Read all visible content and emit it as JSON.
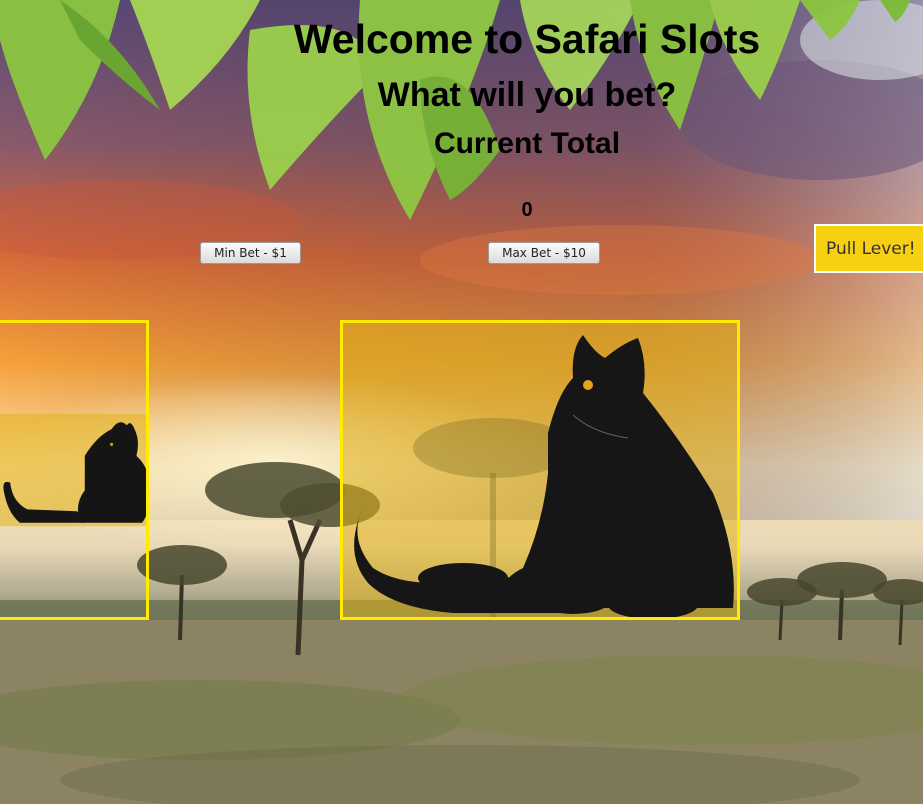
{
  "header": {
    "title": "Welcome to Safari Slots",
    "subtitle": "What will you bet?",
    "total_label": "Current Total",
    "total_value": "0"
  },
  "controls": {
    "min_bet_label": "Min Bet - $1",
    "max_bet_label": "Max Bet - $10",
    "lever_label": "Pull Lever!"
  },
  "slots": [
    {
      "icon": "black-panther-icon"
    },
    {
      "icon": "black-panther-icon"
    }
  ],
  "colors": {
    "slot_border": "#ffea00",
    "lever_bg": "#f7cf13"
  }
}
